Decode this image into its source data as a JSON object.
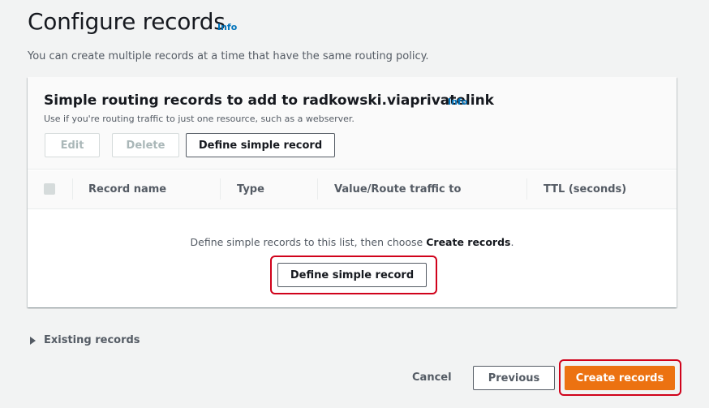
{
  "page": {
    "title": "Configure records",
    "info_label": "Info",
    "description": "You can create multiple records at a time that have the same routing policy."
  },
  "panel": {
    "title": "Simple routing records to add to radkowski.viaprivatelink",
    "info_label": "Info",
    "description": "Use if you're routing traffic to just one resource, such as a webserver.",
    "buttons": {
      "edit": "Edit",
      "delete": "Delete",
      "define": "Define simple record"
    },
    "columns": [
      "Record name",
      "Type",
      "Value/Route traffic to",
      "TTL (seconds)"
    ],
    "empty": {
      "message_prefix": "Define simple records to this list, then choose ",
      "message_bold": "Create records",
      "message_suffix": ".",
      "button": "Define simple record"
    }
  },
  "existing_records": {
    "label": "Existing records"
  },
  "footer": {
    "cancel": "Cancel",
    "previous": "Previous",
    "create": "Create records"
  },
  "colors": {
    "primary": "#ec7211",
    "link": "#0073bb",
    "highlight": "#d0021b"
  },
  "icons": {
    "existing_records_toggle": "caret-right-icon",
    "select_all": "checkbox-icon"
  }
}
